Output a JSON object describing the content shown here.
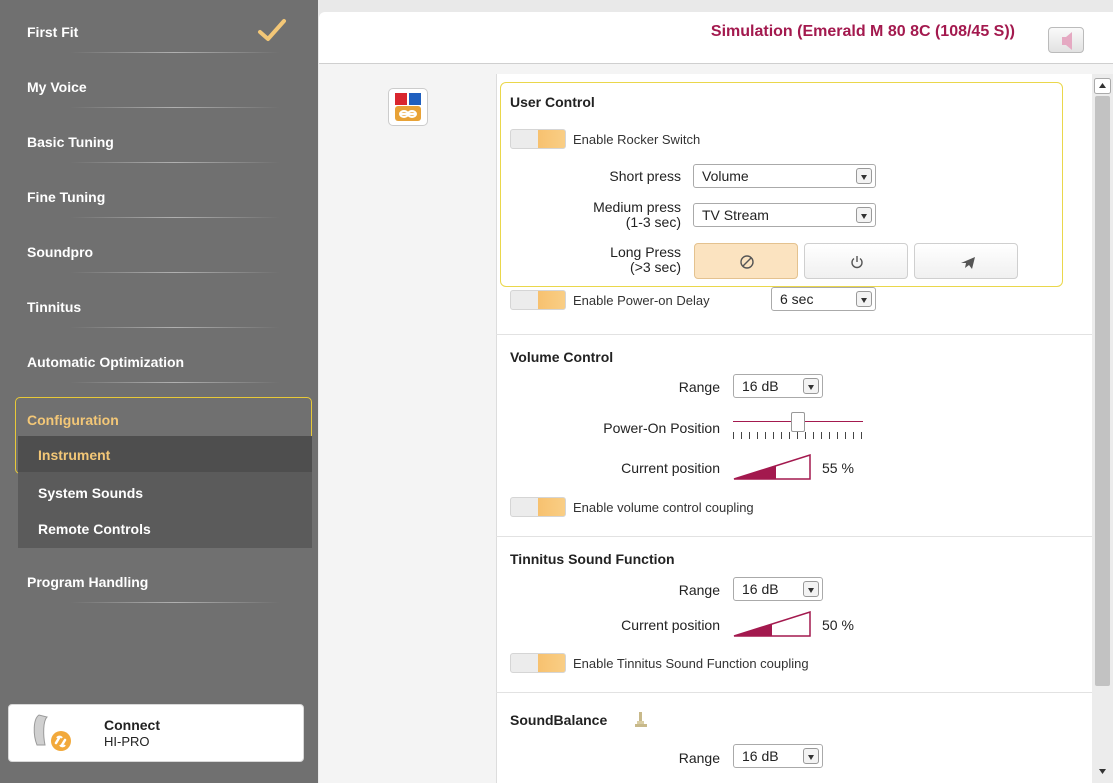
{
  "sidebar": {
    "items": [
      {
        "label": "First Fit",
        "done": true
      },
      {
        "label": "My Voice"
      },
      {
        "label": "Basic Tuning"
      },
      {
        "label": "Fine Tuning"
      },
      {
        "label": "Soundpro"
      },
      {
        "label": "Tinnitus"
      },
      {
        "label": "Automatic Optimization"
      }
    ],
    "configuration": {
      "label": "Configuration",
      "sub_items": [
        "Instrument",
        "System Sounds",
        "Remote Controls"
      ],
      "active_sub_item": "Instrument"
    },
    "program_handling": "Program Handling",
    "connect": {
      "title": "Connect",
      "device": "HI-PRO"
    }
  },
  "header": {
    "title": "Simulation (Emerald M 80 8C (108/45 S))",
    "speaker_icon": "speaker-muted-icon"
  },
  "user_control": {
    "title": "User Control",
    "rocker_toggle": "Enable Rocker Switch",
    "short_press_label": "Short press",
    "short_press_value": "Volume",
    "medium_press_label_1": "Medium press",
    "medium_press_label_2": "(1-3 sec)",
    "medium_press_value": "TV Stream",
    "long_press_label_1": "Long Press",
    "long_press_label_2": "(>3 sec)",
    "long_press_options": [
      "none-icon",
      "power-icon",
      "airplane-icon"
    ],
    "long_press_selected": "none-icon",
    "power_on_delay_toggle": "Enable Power-on Delay",
    "power_on_delay_value": "6 sec"
  },
  "volume_control": {
    "title": "Volume Control",
    "range_label": "Range",
    "range_value": "16 dB",
    "power_on_label": "Power-On Position",
    "power_on_level": 0.5,
    "current_label": "Current position",
    "current_value": "55 %",
    "coupling_toggle": "Enable volume control coupling"
  },
  "tinnitus": {
    "title": "Tinnitus Sound Function",
    "range_label": "Range",
    "range_value": "16 dB",
    "current_label": "Current position",
    "current_value": "50 %",
    "coupling_toggle": "Enable Tinnitus Sound Function coupling"
  },
  "sound_balance": {
    "title": "SoundBalance",
    "range_label": "Range",
    "range_value": "16 dB"
  },
  "colors": {
    "accent": "#a3194e",
    "highlight_border": "#e8c938",
    "toggle_on": "#f7c16f",
    "sidebar_bg": "#707070"
  }
}
